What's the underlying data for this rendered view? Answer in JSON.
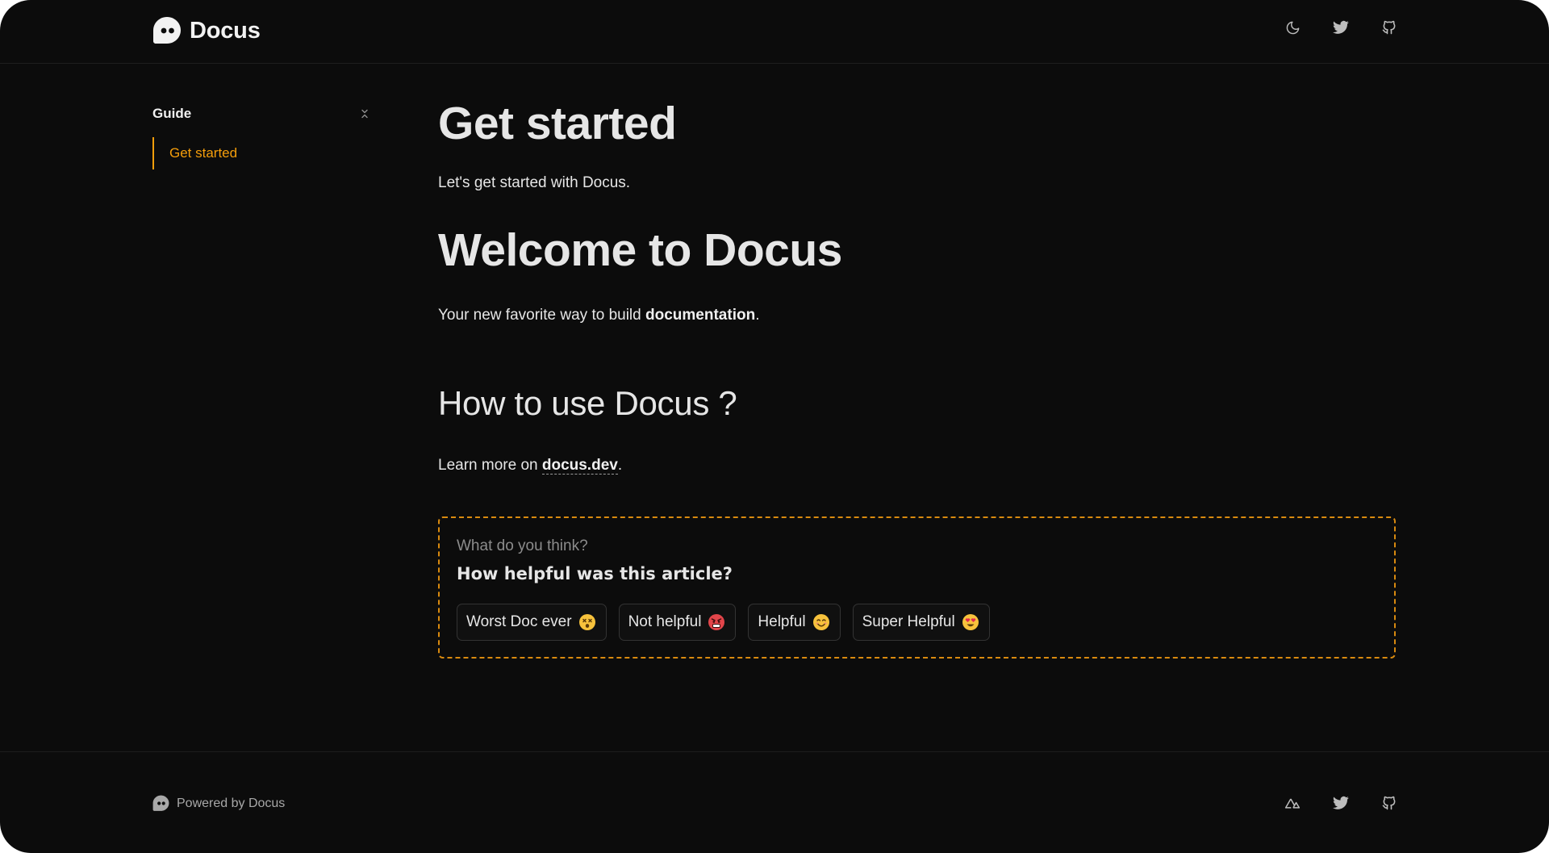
{
  "header": {
    "brand_name": "Docus",
    "icons": [
      "moon-icon",
      "twitter-icon",
      "github-icon"
    ]
  },
  "sidebar": {
    "group_title": "Guide",
    "links": [
      {
        "label": "Get started",
        "active": true
      }
    ]
  },
  "main": {
    "title": "Get started",
    "description": "Let's get started with Docus.",
    "welcome_heading": "Welcome to Docus",
    "welcome_text_before": "Your new favorite way to build ",
    "welcome_text_bold": "documentation",
    "welcome_text_after": ".",
    "howto_heading": "How to use Docus ?",
    "learn_before": "Learn more on ",
    "learn_link": "docus.dev",
    "learn_after": "."
  },
  "feedback": {
    "question": "What do you think?",
    "title": "How helpful was this article?",
    "buttons": [
      {
        "label": "Worst Doc ever",
        "emoji": "dizzy-face"
      },
      {
        "label": "Not helpful",
        "emoji": "angry-face"
      },
      {
        "label": "Helpful",
        "emoji": "smiling-face"
      },
      {
        "label": "Super Helpful",
        "emoji": "heart-eyes-face"
      }
    ]
  },
  "footer": {
    "powered_by": "Powered by Docus",
    "icons": [
      "nuxt-icon",
      "twitter-icon",
      "github-icon"
    ]
  },
  "colors": {
    "background": "#0c0c0c",
    "accent": "#f59e0b",
    "text": "#e6e6e6",
    "muted": "#8c8c8c"
  }
}
